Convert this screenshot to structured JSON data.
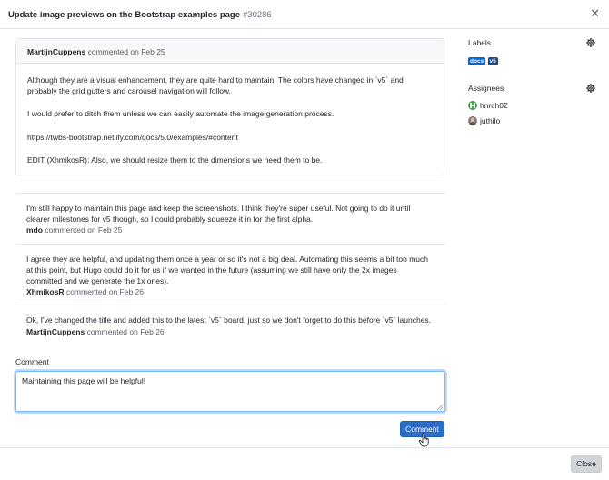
{
  "modal": {
    "title": "Update image previews on the Bootstrap examples page",
    "issue_number": "#30286",
    "close_icon": "close-icon"
  },
  "opening_comment": {
    "author": "MartijnCuppens",
    "meta": "commented on Feb 25",
    "paragraphs": [
      "Although they are a visual enhancement, they are quite hard to maintain. The colors have changed in `v5` and probably the grid gutters and carousel navigation will follow.",
      "I would prefer to ditch them unless we can easily automate the image generation process.",
      "https://twbs-bootstrap.netlify.com/docs/5.0/examples/#content",
      "EDIT (XhmikosR): Also, we should resize them to the dimensions we need them to be."
    ]
  },
  "timeline": [
    {
      "text": "I'm still happy to maintain this page and keep the screenshots. I think they're super useful. Not going to do it until clearer milestones for v5 though, so I could probably squeeze it in for the first alpha.",
      "author": "mdo",
      "meta": "commented on Feb 25"
    },
    {
      "text": "I agree they are helpful, and updating them once a year or so it's not a big deal. Automating this seems a bit too much at this point, but Hugo could do it for us if we wanted in the future (assuming we still have only the 2x images committed and we generate the 1x ones).",
      "author": "XhmikosR",
      "meta": "commented on Feb 26"
    },
    {
      "text": "Ok, I've changed the title and added this to the latest `v5` board, just so we don't forget to do this before `v5` launches.",
      "author": "MartijnCuppens",
      "meta": "commented on Feb 26"
    }
  ],
  "comment_form": {
    "label": "Comment",
    "value": "Maintaining this page will be helpful!",
    "submit_label": "Comment"
  },
  "sidebar": {
    "labels_title": "Labels",
    "labels": [
      {
        "name": "docs",
        "color": "#0366d6"
      },
      {
        "name": "v5",
        "color": "#1d4a8f"
      }
    ],
    "assignees_title": "Assignees",
    "assignees": [
      {
        "name": "hnrch02",
        "avatar_color": "#3fa34d"
      },
      {
        "name": "juthilo",
        "avatar_color": "#8a7f76"
      }
    ],
    "gear_icon": "gear-icon"
  },
  "footer": {
    "close_label": "Close"
  }
}
